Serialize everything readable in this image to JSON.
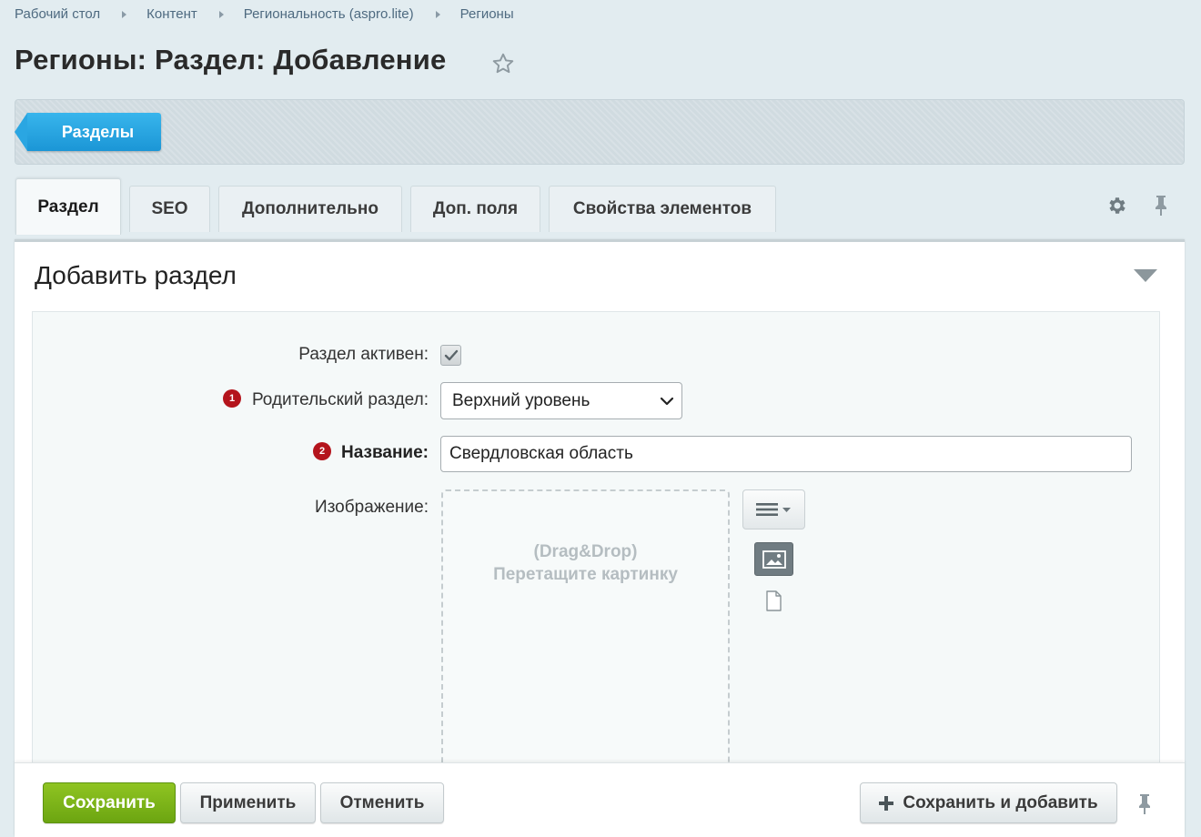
{
  "breadcrumbs": [
    "Рабочий стол",
    "Контент",
    "Региональность (aspro.lite)",
    "Регионы"
  ],
  "page_title": "Регионы: Раздел: Добавление",
  "toolbar": {
    "sections_label": "Разделы"
  },
  "tabs": [
    {
      "label": "Раздел",
      "active": true
    },
    {
      "label": "SEO",
      "active": false
    },
    {
      "label": "Дополнительно",
      "active": false
    },
    {
      "label": "Доп. поля",
      "active": false
    },
    {
      "label": "Свойства элементов",
      "active": false
    }
  ],
  "card_title": "Добавить раздел",
  "form": {
    "active": {
      "label": "Раздел активен:",
      "checked": true
    },
    "parent": {
      "label": "Родительский раздел:",
      "badge": "1",
      "value": "Верхний уровень"
    },
    "name": {
      "label": "Название:",
      "badge": "2",
      "value": "Свердловская область"
    },
    "image": {
      "label": "Изображение:",
      "drop_line1": "(Drag&Drop)",
      "drop_line2": "Перетащите картинку"
    }
  },
  "footer": {
    "save_label": "Сохранить",
    "apply_label": "Применить",
    "cancel_label": "Отменить",
    "save_add_label": "Сохранить и добавить"
  },
  "colors": {
    "accent_blue": "#1b96d6",
    "save_green": "#7ab51a",
    "required_red": "#b4141c",
    "background": "#e2ecf0"
  }
}
